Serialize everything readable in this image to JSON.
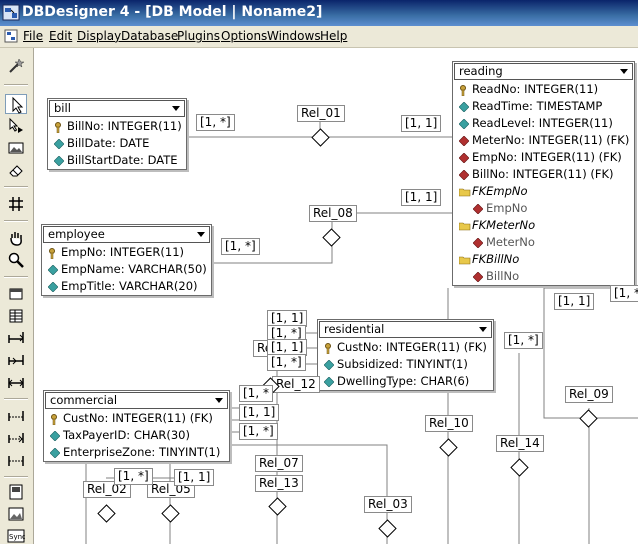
{
  "window": {
    "title": "DBDesigner 4 - [DB Model | Noname2]"
  },
  "menu": [
    "File",
    "Edit",
    "Display",
    "Database",
    "Plugins",
    "Options",
    "Windows",
    "Help"
  ],
  "toolbar_icons": [
    "wand-icon",
    "pointer-icon",
    "select-icon",
    "image-icon",
    "eraser-icon",
    "grid-icon",
    "hand-icon",
    "magnifier-icon",
    "table-icon",
    "view-icon",
    "relation-1n-icon",
    "relation-11-icon",
    "relation-nm-icon",
    "relation-1n-sub-icon",
    "relation-11-sub-icon",
    "relation-nm-sub-icon",
    "note-icon",
    "image-region-icon",
    "sync-icon"
  ],
  "tables": {
    "bill": {
      "name": "bill",
      "columns": [
        {
          "icon": "key",
          "text": "BillNo: INTEGER(11)"
        },
        {
          "icon": "attr",
          "text": "BillDate: DATE"
        },
        {
          "icon": "attr",
          "text": "BillStartDate: DATE"
        }
      ]
    },
    "employee": {
      "name": "employee",
      "columns": [
        {
          "icon": "key",
          "text": "EmpNo: INTEGER(11)"
        },
        {
          "icon": "attr",
          "text": "EmpName: VARCHAR(50)"
        },
        {
          "icon": "attr",
          "text": "EmpTitle: VARCHAR(20)"
        }
      ]
    },
    "reading": {
      "name": "reading",
      "columns": [
        {
          "icon": "key",
          "text": "ReadNo: INTEGER(11)"
        },
        {
          "icon": "attr",
          "text": "ReadTime: TIMESTAMP"
        },
        {
          "icon": "attr",
          "text": "ReadLevel: INTEGER(11)"
        },
        {
          "icon": "fk",
          "text": "MeterNo: INTEGER(11) (FK)"
        },
        {
          "icon": "fk",
          "text": "EmpNo: INTEGER(11) (FK)"
        },
        {
          "icon": "fk",
          "text": "BillNo: INTEGER(11) (FK)"
        },
        {
          "icon": "folder",
          "text": "FKEmpNo"
        },
        {
          "icon": "sub",
          "text": "EmpNo"
        },
        {
          "icon": "folder",
          "text": "FKMeterNo"
        },
        {
          "icon": "sub",
          "text": "MeterNo"
        },
        {
          "icon": "folder",
          "text": "FKBillNo"
        },
        {
          "icon": "sub",
          "text": "BillNo"
        }
      ]
    },
    "residential": {
      "name": "residential",
      "columns": [
        {
          "icon": "key",
          "text": "CustNo: INTEGER(11) (FK)"
        },
        {
          "icon": "attr",
          "text": "Subsidized: TINYINT(1)"
        },
        {
          "icon": "attr",
          "text": "DwellingType: CHAR(6)"
        }
      ]
    },
    "commercial": {
      "name": "commercial",
      "columns": [
        {
          "icon": "key",
          "text": "CustNo: INTEGER(11) (FK)"
        },
        {
          "icon": "attr",
          "text": "TaxPayerID: CHAR(30)"
        },
        {
          "icon": "attr",
          "text": "EnterpriseZone: TINYINT(1)"
        }
      ]
    }
  },
  "relations": [
    "Rel_01",
    "Rel_08",
    "Rel_12",
    "Rel_07",
    "Rel_13",
    "Rel_02",
    "Rel_05",
    "Rel_03",
    "Rel_10",
    "Rel_14",
    "Rel_09",
    "Rel"
  ],
  "cardinality": {
    "many": "[1, *]",
    "one": "[1, 1]",
    "one_short": "[1, 1",
    "many_short": "[1, *",
    "many_clip": "[1, *]",
    "one_bracket": "1]"
  },
  "colors": {
    "titlebar": "#0a246a",
    "menubar": "#ece9d8",
    "key": "#c8a23c",
    "attr": "#3aa0a0",
    "fk": "#b03030",
    "folder": "#e8c84a"
  }
}
